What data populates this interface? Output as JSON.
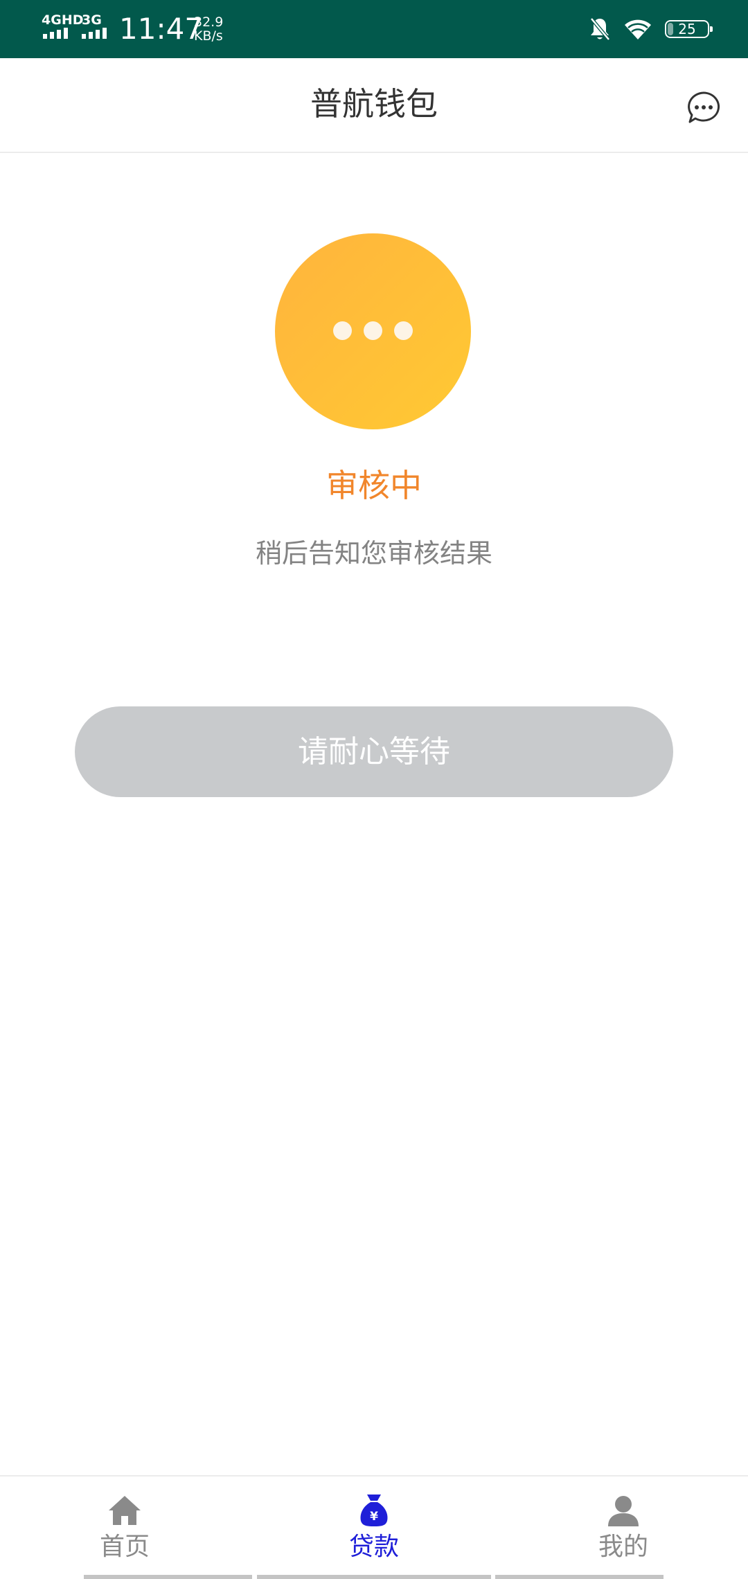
{
  "status_bar": {
    "network_1": "4GHD",
    "network_2": "3G",
    "time": "11:47",
    "speed_value": "32.9",
    "speed_unit": "KB/s",
    "battery": "25",
    "icons": [
      "bell-muted-icon",
      "wifi-icon",
      "battery-icon"
    ]
  },
  "header": {
    "title": "普航钱包",
    "message_icon": "chat-bubble-icon"
  },
  "review": {
    "status_icon": "pending-dots-icon",
    "title": "审核中",
    "description": "稍后告知您审核结果",
    "button_label": "请耐心等待"
  },
  "tab_bar": {
    "tabs": [
      {
        "label": "首页",
        "icon": "home-icon",
        "active": false
      },
      {
        "label": "贷款",
        "icon": "money-bag-icon",
        "active": true
      },
      {
        "label": "我的",
        "icon": "person-icon",
        "active": false
      }
    ]
  },
  "colors": {
    "status_bar_bg": "#02594c",
    "status_title": "#f1862b",
    "circle_start": "#ffb43d",
    "circle_end": "#ffc933",
    "button_disabled": "#c8cacc",
    "tab_active": "#1f1fd8",
    "tab_inactive": "#8a8a8a"
  }
}
